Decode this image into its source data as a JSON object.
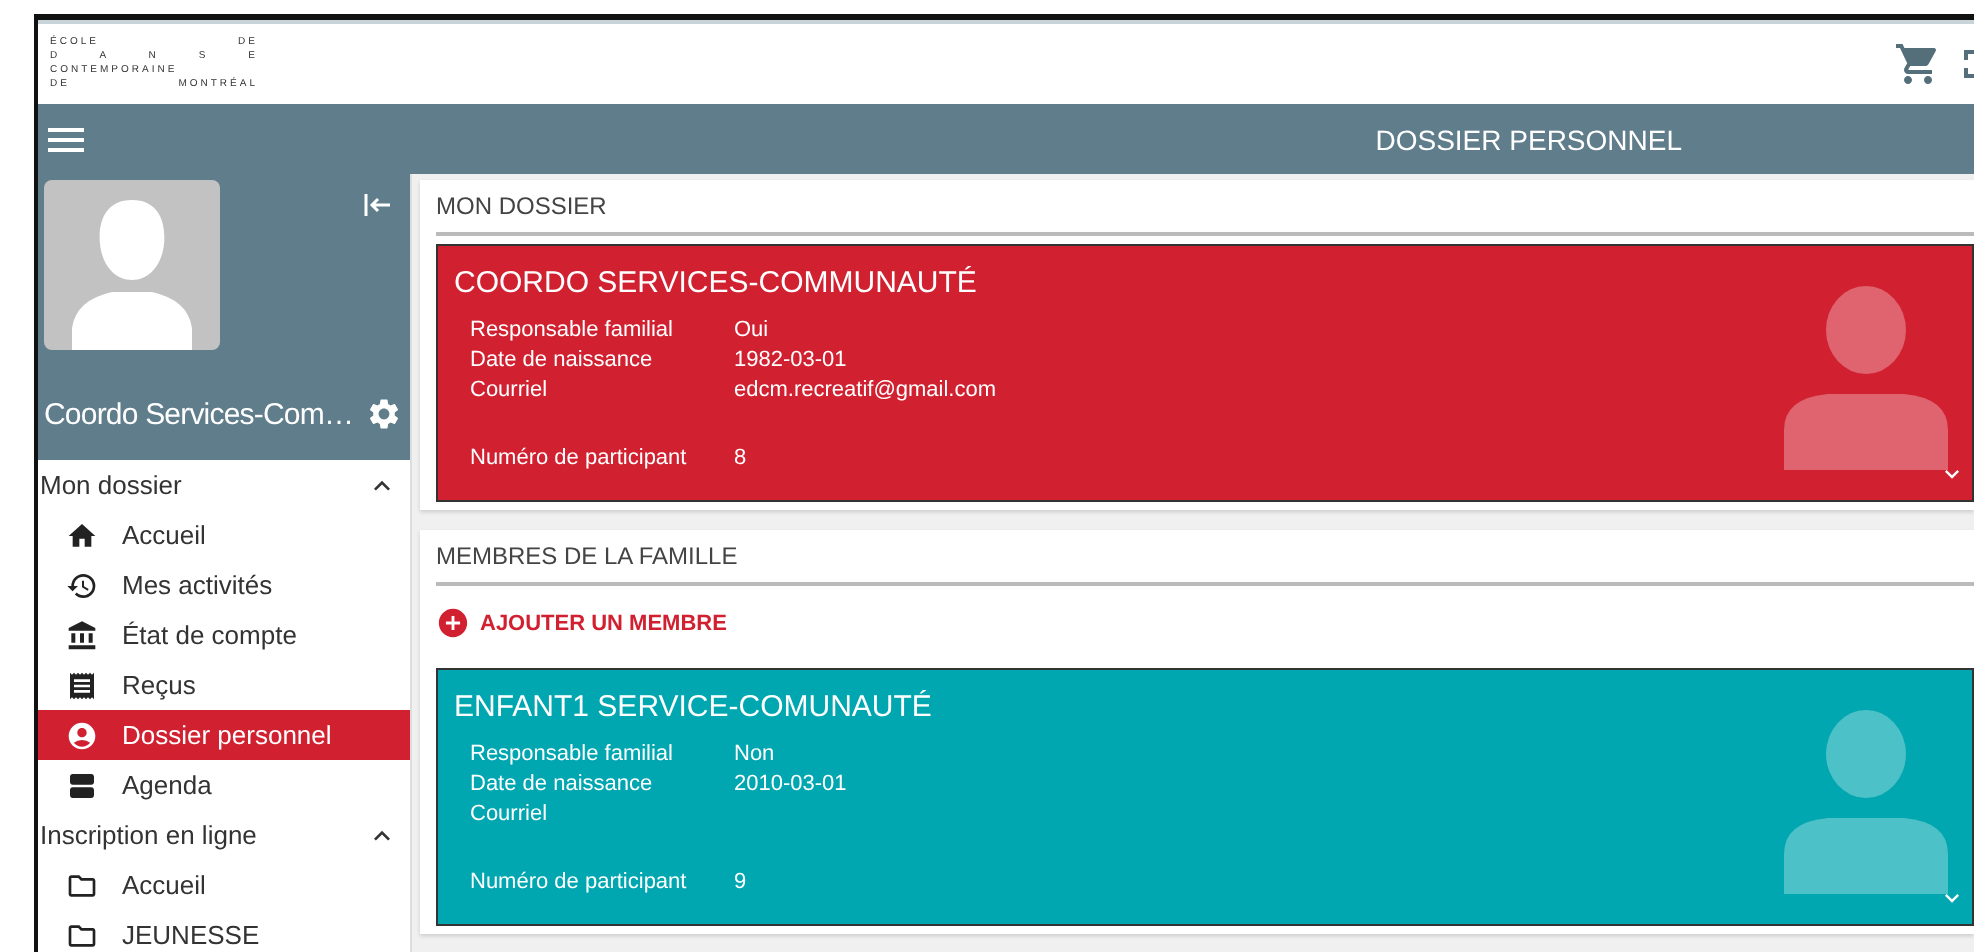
{
  "logo": {
    "lines": [
      "ÉCOLE DE",
      "D A N S E",
      "CONTEMPORAINE",
      "DE MONTRÉAL"
    ]
  },
  "toolbar": {
    "title": "DOSSIER PERSONNEL"
  },
  "profile": {
    "name": "Coordo Services-Com…"
  },
  "sidebar": {
    "sections": [
      {
        "title": "Mon dossier",
        "expanded": true,
        "items": [
          {
            "label": "Accueil",
            "selected": false
          },
          {
            "label": "Mes activités",
            "selected": false
          },
          {
            "label": "État de compte",
            "selected": false
          },
          {
            "label": "Reçus",
            "selected": false
          },
          {
            "label": "Dossier personnel",
            "selected": true
          },
          {
            "label": "Agenda",
            "selected": false
          }
        ]
      },
      {
        "title": "Inscription en ligne",
        "expanded": true,
        "items": [
          {
            "label": "Accueil",
            "selected": false
          },
          {
            "label": "JEUNESSE",
            "selected": false
          }
        ]
      }
    ]
  },
  "panels": [
    {
      "title": "MON DOSSIER",
      "cards": [
        {
          "name": "COORDO SERVICES-COMMUNAUTÉ",
          "color": "#d12131",
          "fields": [
            {
              "label": "Responsable familial",
              "value": "Oui"
            },
            {
              "label": "Date de naissance",
              "value": "1982-03-01"
            },
            {
              "label": "Courriel",
              "value": "edcm.recreatif@gmail.com"
            }
          ],
          "footer_field": {
            "label": "Numéro de participant",
            "value": "8"
          }
        }
      ]
    },
    {
      "title": "MEMBRES DE LA FAMILLE",
      "add_button": "AJOUTER UN MEMBRE",
      "cards": [
        {
          "name": "ENFANT1 SERVICE-COMUNAUTÉ",
          "color": "#00a6b0",
          "fields": [
            {
              "label": "Responsable familial",
              "value": "Non"
            },
            {
              "label": "Date de naissance",
              "value": "2010-03-01"
            },
            {
              "label": "Courriel"
            }
          ],
          "footer_field": {
            "label": "Numéro de participant",
            "value": "9"
          }
        }
      ]
    }
  ]
}
